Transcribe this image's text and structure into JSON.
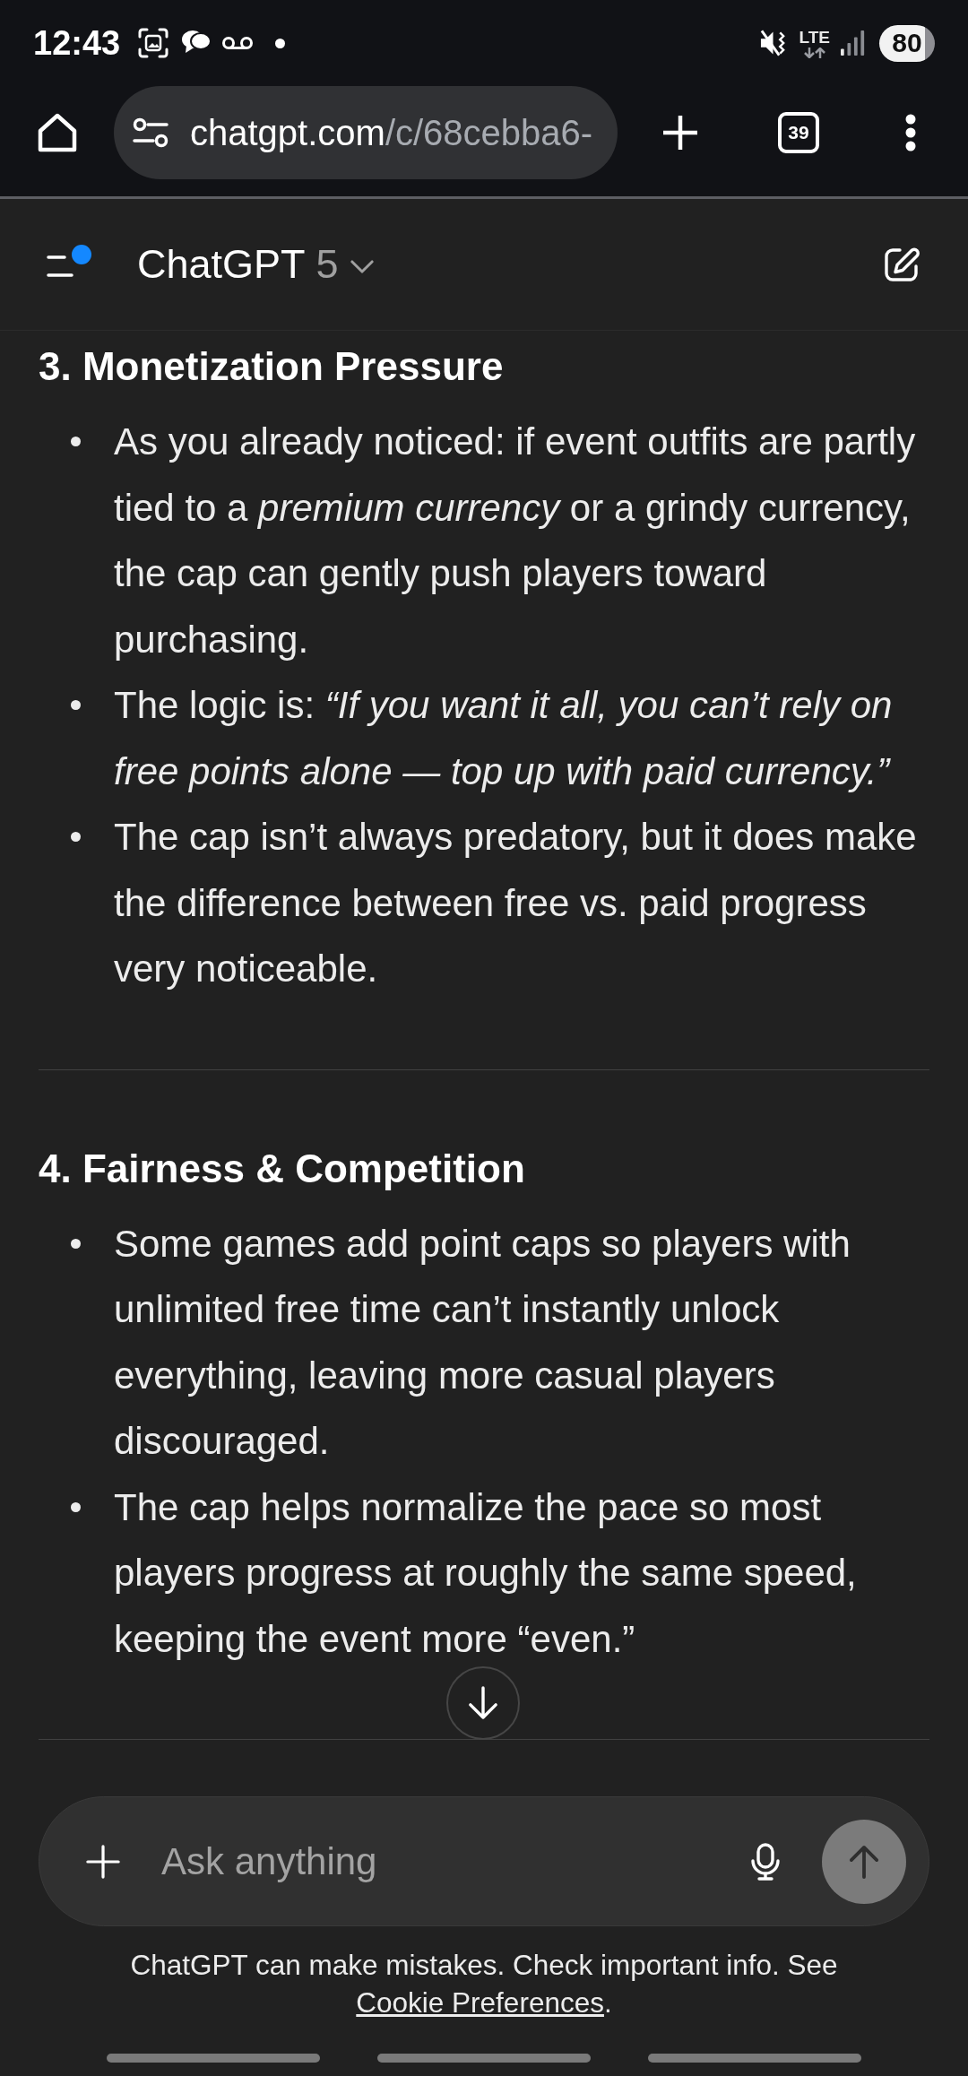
{
  "status_bar": {
    "time": "12:43",
    "network": "LTE",
    "battery": "80"
  },
  "browser_bar": {
    "url_domain": "chatgpt.com",
    "url_path": "/c/68cebba6-",
    "tab_count": "39"
  },
  "chat_header": {
    "title": "ChatGPT",
    "model": "5",
    "unread": true
  },
  "sections": [
    {
      "heading": "3. Monetization Pressure",
      "bullets": [
        "As you already noticed: if event outfits are partly tied to a *premium currency* or a grindy currency, the cap can gently push players toward purchasing.",
        "The logic is: *“If you want it all, you can’t rely on free points alone — top up with paid currency.”*",
        "The cap isn’t always predatory, but it does make the difference between free vs. paid progress very noticeable."
      ]
    },
    {
      "heading": "4. Fairness & Competition",
      "bullets": [
        "Some games add point caps so players with unlimited free time can’t instantly unlock everything, leaving more casual players discouraged.",
        "The cap helps normalize the pace so most players progress at roughly the same speed, keeping the event more “even.”"
      ]
    }
  ],
  "composer": {
    "placeholder": "Ask anything"
  },
  "footer": {
    "disclaimer": "ChatGPT can make mistakes. Check important info. See",
    "link": "Cookie Preferences",
    "link_suffix": "."
  }
}
